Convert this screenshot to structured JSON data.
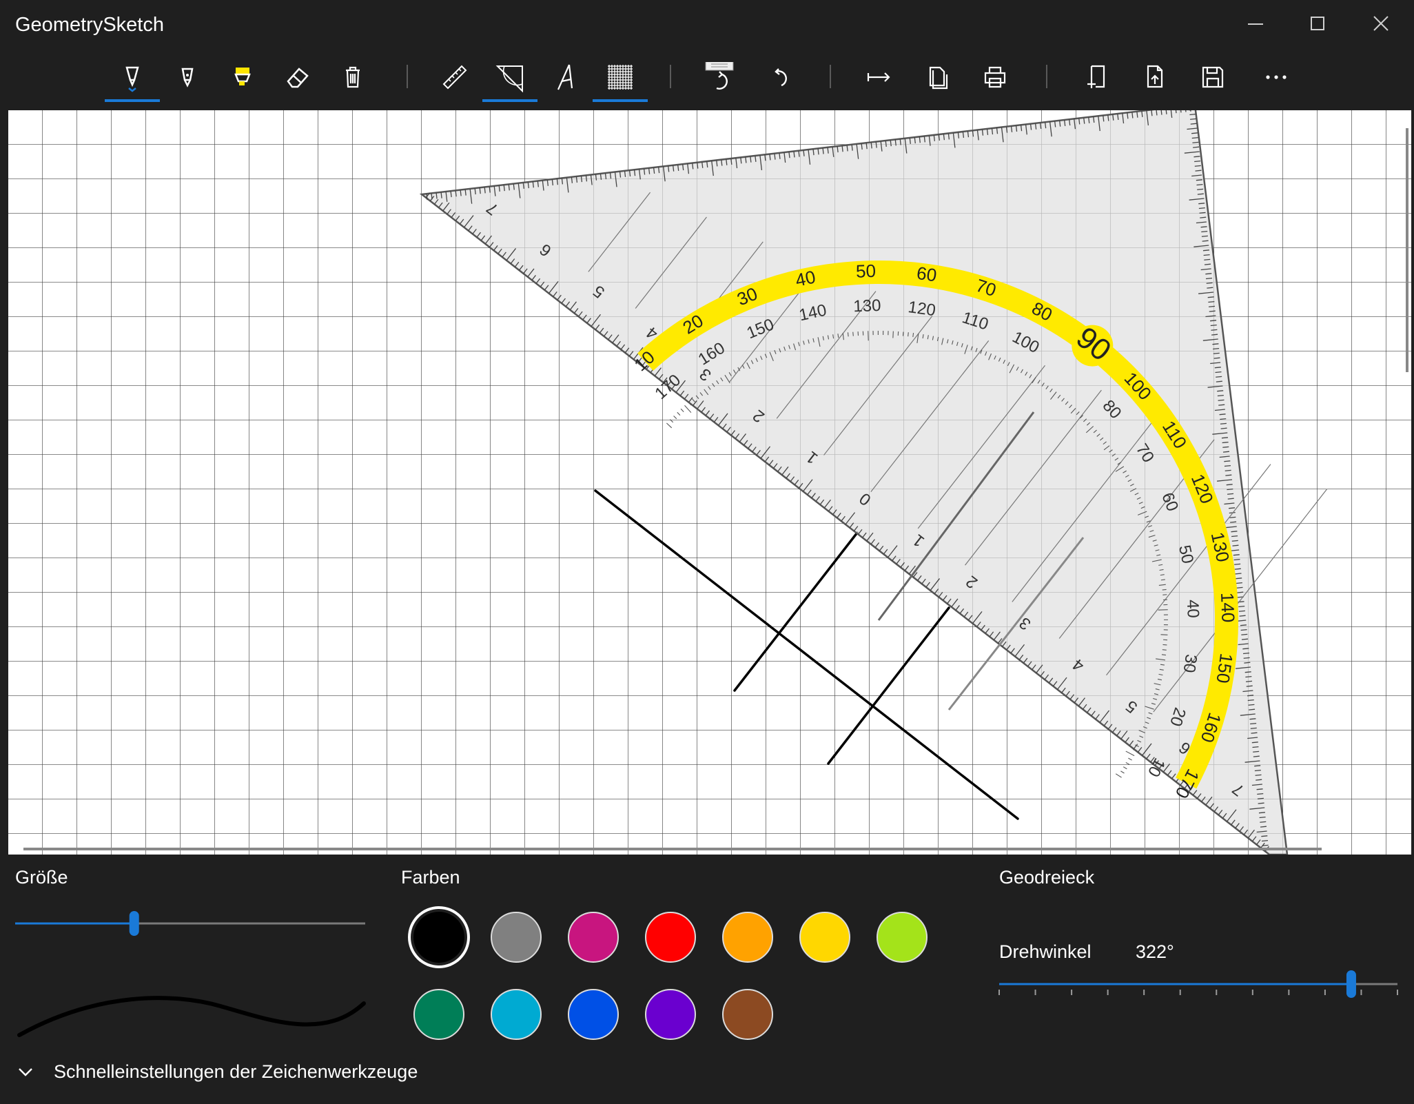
{
  "app": {
    "title": "GeometrySketch"
  },
  "window_controls": [
    {
      "name": "minimize-button",
      "icon": "minimize-icon"
    },
    {
      "name": "maximize-button",
      "icon": "maximize-icon"
    },
    {
      "name": "close-button",
      "icon": "close-icon"
    }
  ],
  "toolbar": {
    "accent_color": "#1a7ad8",
    "tools": [
      {
        "id": "pen",
        "icon": "pen-icon",
        "selected": true
      },
      {
        "id": "pencil",
        "icon": "pencil-icon",
        "selected": false
      },
      {
        "id": "highlighter",
        "icon": "highlighter-icon",
        "selected": false
      },
      {
        "id": "eraser",
        "icon": "eraser-icon",
        "selected": false
      },
      {
        "id": "delete",
        "icon": "trash-icon",
        "selected": false
      },
      {
        "id": "ruler",
        "icon": "ruler-icon",
        "selected": false
      },
      {
        "id": "set-square",
        "icon": "set-square-icon",
        "selected": true
      },
      {
        "id": "compass",
        "icon": "compass-icon",
        "selected": false
      },
      {
        "id": "grid",
        "icon": "grid-icon",
        "selected": true
      },
      {
        "id": "redo",
        "icon": "redo-icon",
        "selected": false
      },
      {
        "id": "undo",
        "icon": "undo-icon",
        "selected": false
      },
      {
        "id": "move-right",
        "icon": "arrow-right-bar-icon",
        "selected": false
      },
      {
        "id": "copy",
        "icon": "copy-icon",
        "selected": false
      },
      {
        "id": "print",
        "icon": "print-icon",
        "selected": false
      },
      {
        "id": "new-page",
        "icon": "new-page-icon",
        "selected": false
      },
      {
        "id": "open-file",
        "icon": "open-file-icon",
        "selected": false
      },
      {
        "id": "save",
        "icon": "save-icon",
        "selected": false
      },
      {
        "id": "more",
        "icon": "more-icon",
        "selected": false
      }
    ]
  },
  "set_square": {
    "protractor_inner_labels": [
      "10",
      "20",
      "30",
      "40",
      "50",
      "60",
      "70",
      "80",
      "100",
      "110",
      "120",
      "130",
      "140",
      "150",
      "160",
      "170"
    ],
    "protractor_outer_labels": [
      "170",
      "160",
      "150",
      "140",
      "130",
      "120",
      "110",
      "100",
      "90",
      "80",
      "70",
      "60",
      "50",
      "40",
      "30",
      "20",
      "10"
    ],
    "hypotenuse_labels": [
      "7",
      "6",
      "5",
      "4",
      "3",
      "2",
      "1",
      "0",
      "1",
      "2",
      "3",
      "4",
      "5",
      "6",
      "7"
    ],
    "inner_scale_labels": [
      "3",
      "2",
      "1",
      "1",
      "2",
      "3"
    ]
  },
  "settings": {
    "size": {
      "label": "Größe",
      "value": 0.34
    },
    "colors": {
      "label": "Farben",
      "swatches": [
        "#000000",
        "#808080",
        "#c8157f",
        "#ff0000",
        "#ffa200",
        "#ffd700",
        "#a4e31a",
        "#007e57",
        "#00aad2",
        "#0050e6",
        "#6a00cf",
        "#8c4a22"
      ],
      "selected": 0
    },
    "geodreieck": {
      "label": "Geodreieck",
      "rotation_label": "Drehwinkel",
      "rotation_value": "322°",
      "slider_value": 0.884
    },
    "quick_settings_label": "Schnelleinstellungen der Zeichenwerkzeuge"
  }
}
